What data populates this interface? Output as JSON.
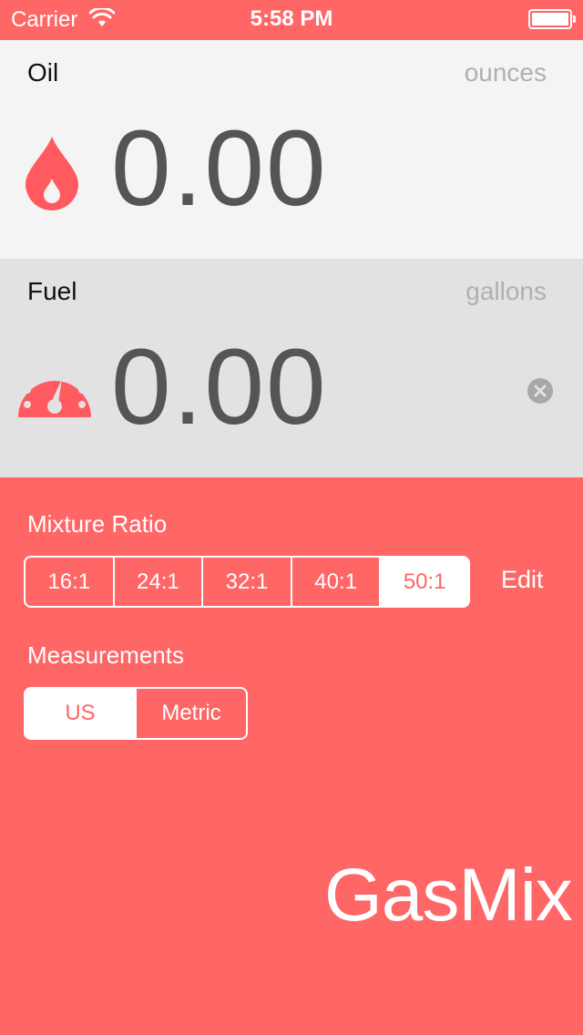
{
  "status_bar": {
    "carrier": "Carrier",
    "time": "5:58 PM"
  },
  "oil": {
    "label": "Oil",
    "unit": "ounces",
    "value": "0.00",
    "icon": "drop-icon"
  },
  "fuel": {
    "label": "Fuel",
    "unit": "gallons",
    "value": "0.00",
    "icon": "gauge-icon"
  },
  "mixture": {
    "title": "Mixture Ratio",
    "options": [
      "16:1",
      "24:1",
      "32:1",
      "40:1",
      "50:1"
    ],
    "selected": "50:1",
    "edit_label": "Edit"
  },
  "measurements": {
    "title": "Measurements",
    "options": [
      "US",
      "Metric"
    ],
    "selected": "US"
  },
  "app_name": "GasMix",
  "colors": {
    "accent": "#ff6666",
    "oil_bg": "#f4f4f4",
    "fuel_bg": "#e2e2e2",
    "value_text": "#555555",
    "unit_text": "#b0b0b0"
  }
}
